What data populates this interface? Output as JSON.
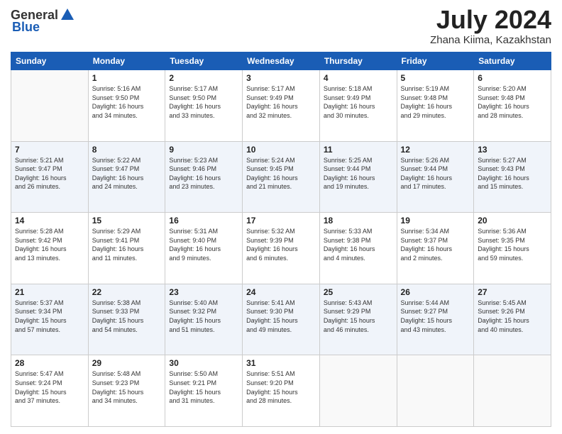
{
  "logo": {
    "general": "General",
    "blue": "Blue"
  },
  "title": "July 2024",
  "location": "Zhana Kiima, Kazakhstan",
  "days_of_week": [
    "Sunday",
    "Monday",
    "Tuesday",
    "Wednesday",
    "Thursday",
    "Friday",
    "Saturday"
  ],
  "weeks": [
    [
      {
        "day": "",
        "info": ""
      },
      {
        "day": "1",
        "info": "Sunrise: 5:16 AM\nSunset: 9:50 PM\nDaylight: 16 hours\nand 34 minutes."
      },
      {
        "day": "2",
        "info": "Sunrise: 5:17 AM\nSunset: 9:50 PM\nDaylight: 16 hours\nand 33 minutes."
      },
      {
        "day": "3",
        "info": "Sunrise: 5:17 AM\nSunset: 9:49 PM\nDaylight: 16 hours\nand 32 minutes."
      },
      {
        "day": "4",
        "info": "Sunrise: 5:18 AM\nSunset: 9:49 PM\nDaylight: 16 hours\nand 30 minutes."
      },
      {
        "day": "5",
        "info": "Sunrise: 5:19 AM\nSunset: 9:48 PM\nDaylight: 16 hours\nand 29 minutes."
      },
      {
        "day": "6",
        "info": "Sunrise: 5:20 AM\nSunset: 9:48 PM\nDaylight: 16 hours\nand 28 minutes."
      }
    ],
    [
      {
        "day": "7",
        "info": "Sunrise: 5:21 AM\nSunset: 9:47 PM\nDaylight: 16 hours\nand 26 minutes."
      },
      {
        "day": "8",
        "info": "Sunrise: 5:22 AM\nSunset: 9:47 PM\nDaylight: 16 hours\nand 24 minutes."
      },
      {
        "day": "9",
        "info": "Sunrise: 5:23 AM\nSunset: 9:46 PM\nDaylight: 16 hours\nand 23 minutes."
      },
      {
        "day": "10",
        "info": "Sunrise: 5:24 AM\nSunset: 9:45 PM\nDaylight: 16 hours\nand 21 minutes."
      },
      {
        "day": "11",
        "info": "Sunrise: 5:25 AM\nSunset: 9:44 PM\nDaylight: 16 hours\nand 19 minutes."
      },
      {
        "day": "12",
        "info": "Sunrise: 5:26 AM\nSunset: 9:44 PM\nDaylight: 16 hours\nand 17 minutes."
      },
      {
        "day": "13",
        "info": "Sunrise: 5:27 AM\nSunset: 9:43 PM\nDaylight: 16 hours\nand 15 minutes."
      }
    ],
    [
      {
        "day": "14",
        "info": "Sunrise: 5:28 AM\nSunset: 9:42 PM\nDaylight: 16 hours\nand 13 minutes."
      },
      {
        "day": "15",
        "info": "Sunrise: 5:29 AM\nSunset: 9:41 PM\nDaylight: 16 hours\nand 11 minutes."
      },
      {
        "day": "16",
        "info": "Sunrise: 5:31 AM\nSunset: 9:40 PM\nDaylight: 16 hours\nand 9 minutes."
      },
      {
        "day": "17",
        "info": "Sunrise: 5:32 AM\nSunset: 9:39 PM\nDaylight: 16 hours\nand 6 minutes."
      },
      {
        "day": "18",
        "info": "Sunrise: 5:33 AM\nSunset: 9:38 PM\nDaylight: 16 hours\nand 4 minutes."
      },
      {
        "day": "19",
        "info": "Sunrise: 5:34 AM\nSunset: 9:37 PM\nDaylight: 16 hours\nand 2 minutes."
      },
      {
        "day": "20",
        "info": "Sunrise: 5:36 AM\nSunset: 9:35 PM\nDaylight: 15 hours\nand 59 minutes."
      }
    ],
    [
      {
        "day": "21",
        "info": "Sunrise: 5:37 AM\nSunset: 9:34 PM\nDaylight: 15 hours\nand 57 minutes."
      },
      {
        "day": "22",
        "info": "Sunrise: 5:38 AM\nSunset: 9:33 PM\nDaylight: 15 hours\nand 54 minutes."
      },
      {
        "day": "23",
        "info": "Sunrise: 5:40 AM\nSunset: 9:32 PM\nDaylight: 15 hours\nand 51 minutes."
      },
      {
        "day": "24",
        "info": "Sunrise: 5:41 AM\nSunset: 9:30 PM\nDaylight: 15 hours\nand 49 minutes."
      },
      {
        "day": "25",
        "info": "Sunrise: 5:43 AM\nSunset: 9:29 PM\nDaylight: 15 hours\nand 46 minutes."
      },
      {
        "day": "26",
        "info": "Sunrise: 5:44 AM\nSunset: 9:27 PM\nDaylight: 15 hours\nand 43 minutes."
      },
      {
        "day": "27",
        "info": "Sunrise: 5:45 AM\nSunset: 9:26 PM\nDaylight: 15 hours\nand 40 minutes."
      }
    ],
    [
      {
        "day": "28",
        "info": "Sunrise: 5:47 AM\nSunset: 9:24 PM\nDaylight: 15 hours\nand 37 minutes."
      },
      {
        "day": "29",
        "info": "Sunrise: 5:48 AM\nSunset: 9:23 PM\nDaylight: 15 hours\nand 34 minutes."
      },
      {
        "day": "30",
        "info": "Sunrise: 5:50 AM\nSunset: 9:21 PM\nDaylight: 15 hours\nand 31 minutes."
      },
      {
        "day": "31",
        "info": "Sunrise: 5:51 AM\nSunset: 9:20 PM\nDaylight: 15 hours\nand 28 minutes."
      },
      {
        "day": "",
        "info": ""
      },
      {
        "day": "",
        "info": ""
      },
      {
        "day": "",
        "info": ""
      }
    ]
  ]
}
